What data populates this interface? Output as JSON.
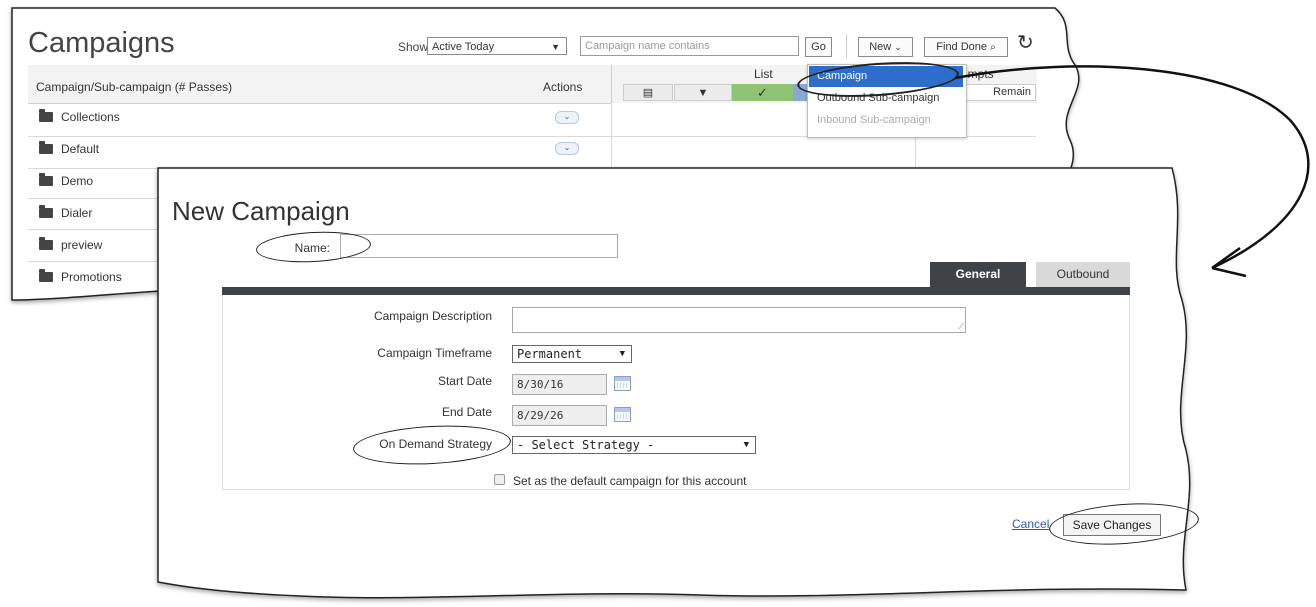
{
  "campaigns_page": {
    "title": "Campaigns",
    "show_label": "Show:",
    "show_value": "Active Today",
    "search_placeholder": "Campaign name contains",
    "go_label": "Go",
    "new_label": "New",
    "find_done_label": "Find Done",
    "columns": {
      "name": "Campaign/Sub-campaign (# Passes)",
      "actions": "Actions",
      "list": "List",
      "attempts": "empts",
      "remain": "Remain"
    },
    "rows": [
      "Collections",
      "Default",
      "Demo",
      "Dialer",
      "preview",
      "Promotions"
    ],
    "new_menu": [
      "Campaign",
      "Outbound Sub-campaign",
      "Inbound Sub-campaign"
    ]
  },
  "form": {
    "title": "New Campaign",
    "name_label": "Name:",
    "name_value": "",
    "tabs": [
      "General",
      "Outbound"
    ],
    "description_label": "Campaign Description",
    "timeframe_label": "Campaign Timeframe",
    "timeframe_value": "Permanent",
    "start_date_label": "Start Date",
    "start_date_value": "8/30/16",
    "end_date_label": "End Date",
    "end_date_value": "8/29/26",
    "strategy_label": "On Demand Strategy",
    "strategy_value": "- Select Strategy -",
    "default_checkbox_label": "Set as the default campaign for this account",
    "cancel_label": "Cancel",
    "save_label": "Save Changes"
  },
  "colors": {
    "highlight_blue": "#2d6dcc",
    "tab_dark": "#3f4348",
    "check_green": "#8fc474"
  }
}
